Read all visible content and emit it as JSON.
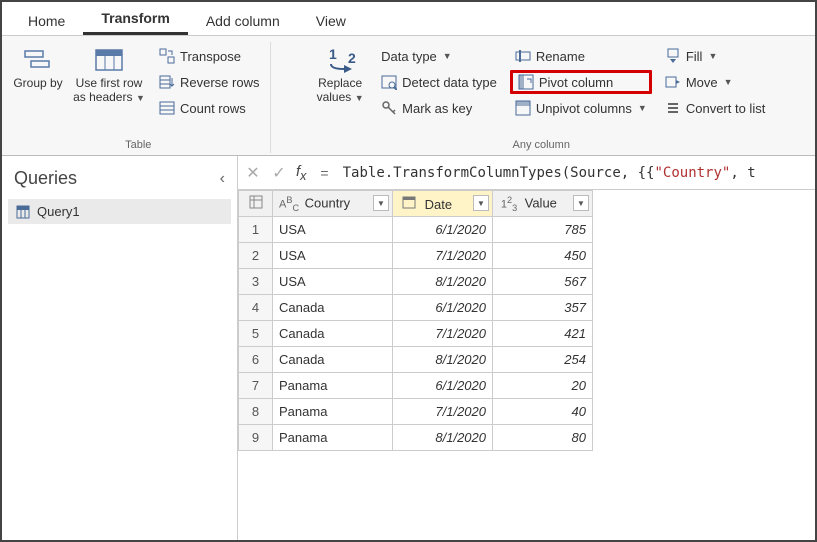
{
  "tabs": {
    "home": "Home",
    "transform": "Transform",
    "add_column": "Add column",
    "view": "View"
  },
  "ribbon": {
    "table_group": "Table",
    "any_column_group": "Any column",
    "group_by": "Group by",
    "first_row_headers": "Use first row as headers",
    "transpose": "Transpose",
    "reverse_rows": "Reverse rows",
    "count_rows": "Count rows",
    "replace_values": "Replace values",
    "data_type": "Data type",
    "detect_data_type": "Detect data type",
    "mark_as_key": "Mark as key",
    "rename": "Rename",
    "pivot_column": "Pivot column",
    "unpivot_columns": "Unpivot columns",
    "fill": "Fill",
    "move": "Move",
    "convert_to_list": "Convert to list"
  },
  "queries": {
    "title": "Queries",
    "items": [
      "Query1"
    ]
  },
  "formula": {
    "prefix": "Table.TransformColumnTypes(Source, {{",
    "str1": "\"Country\"",
    "suffix": ", t"
  },
  "columns": {
    "country": "Country",
    "date": "Date",
    "value": "Value"
  },
  "rows": [
    {
      "n": "1",
      "country": "USA",
      "date": "6/1/2020",
      "value": "785"
    },
    {
      "n": "2",
      "country": "USA",
      "date": "7/1/2020",
      "value": "450"
    },
    {
      "n": "3",
      "country": "USA",
      "date": "8/1/2020",
      "value": "567"
    },
    {
      "n": "4",
      "country": "Canada",
      "date": "6/1/2020",
      "value": "357"
    },
    {
      "n": "5",
      "country": "Canada",
      "date": "7/1/2020",
      "value": "421"
    },
    {
      "n": "6",
      "country": "Canada",
      "date": "8/1/2020",
      "value": "254"
    },
    {
      "n": "7",
      "country": "Panama",
      "date": "6/1/2020",
      "value": "20"
    },
    {
      "n": "8",
      "country": "Panama",
      "date": "7/1/2020",
      "value": "40"
    },
    {
      "n": "9",
      "country": "Panama",
      "date": "8/1/2020",
      "value": "80"
    }
  ]
}
